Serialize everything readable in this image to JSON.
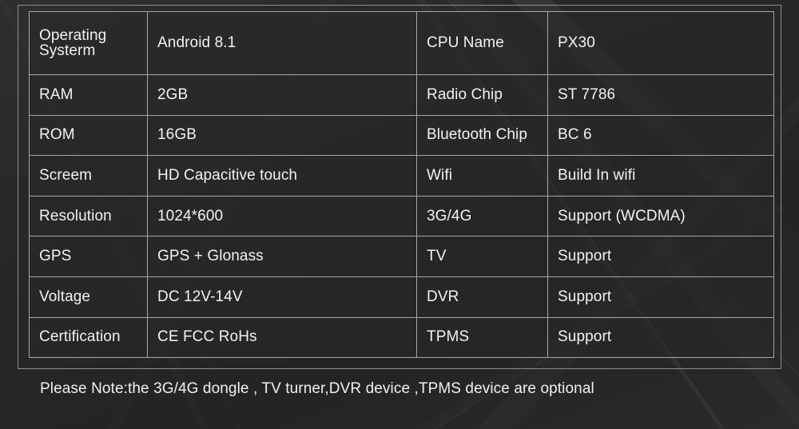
{
  "table": {
    "header": {
      "left_label": "Operating\nSysterm",
      "left_label_line1": "Operating",
      "left_label_line2": "Systerm",
      "left_value": "Android 8.1",
      "right_label": "CPU Name",
      "right_value": "PX30"
    },
    "rows": [
      {
        "left_label": "RAM",
        "left_value": "2GB",
        "right_label": "Radio Chip",
        "right_value": "ST 7786"
      },
      {
        "left_label": "ROM",
        "left_value": "16GB",
        "right_label": "Bluetooth Chip",
        "right_value": "BC 6"
      },
      {
        "left_label": "Screem",
        "left_value": "HD Capacitive touch",
        "right_label": "Wifi",
        "right_value": "Build In wifi"
      },
      {
        "left_label": "Resolution",
        "left_value": "1024*600",
        "right_label": "3G/4G",
        "right_value": "Support (WCDMA)"
      },
      {
        "left_label": "GPS",
        "left_value": "GPS + Glonass",
        "right_label": "TV",
        "right_value": "Support"
      },
      {
        "left_label": "Voltage",
        "left_value": "DC 12V-14V",
        "right_label": "DVR",
        "right_value": "Support"
      },
      {
        "left_label": "Certification",
        "left_value": "CE FCC RoHs",
        "right_label": "TPMS",
        "right_value": "Support"
      }
    ]
  },
  "footer": {
    "note": "Please Note:the 3G/4G dongle , TV turner,DVR device ,TPMS device are optional"
  },
  "colors": {
    "page_background": "#2b2b2d",
    "header_row_background": "#070707",
    "cell_background": "#28282a",
    "grid_line": "#a7a7aa",
    "outer_frame": "#8d8d90",
    "text": "#f2f2f2"
  }
}
